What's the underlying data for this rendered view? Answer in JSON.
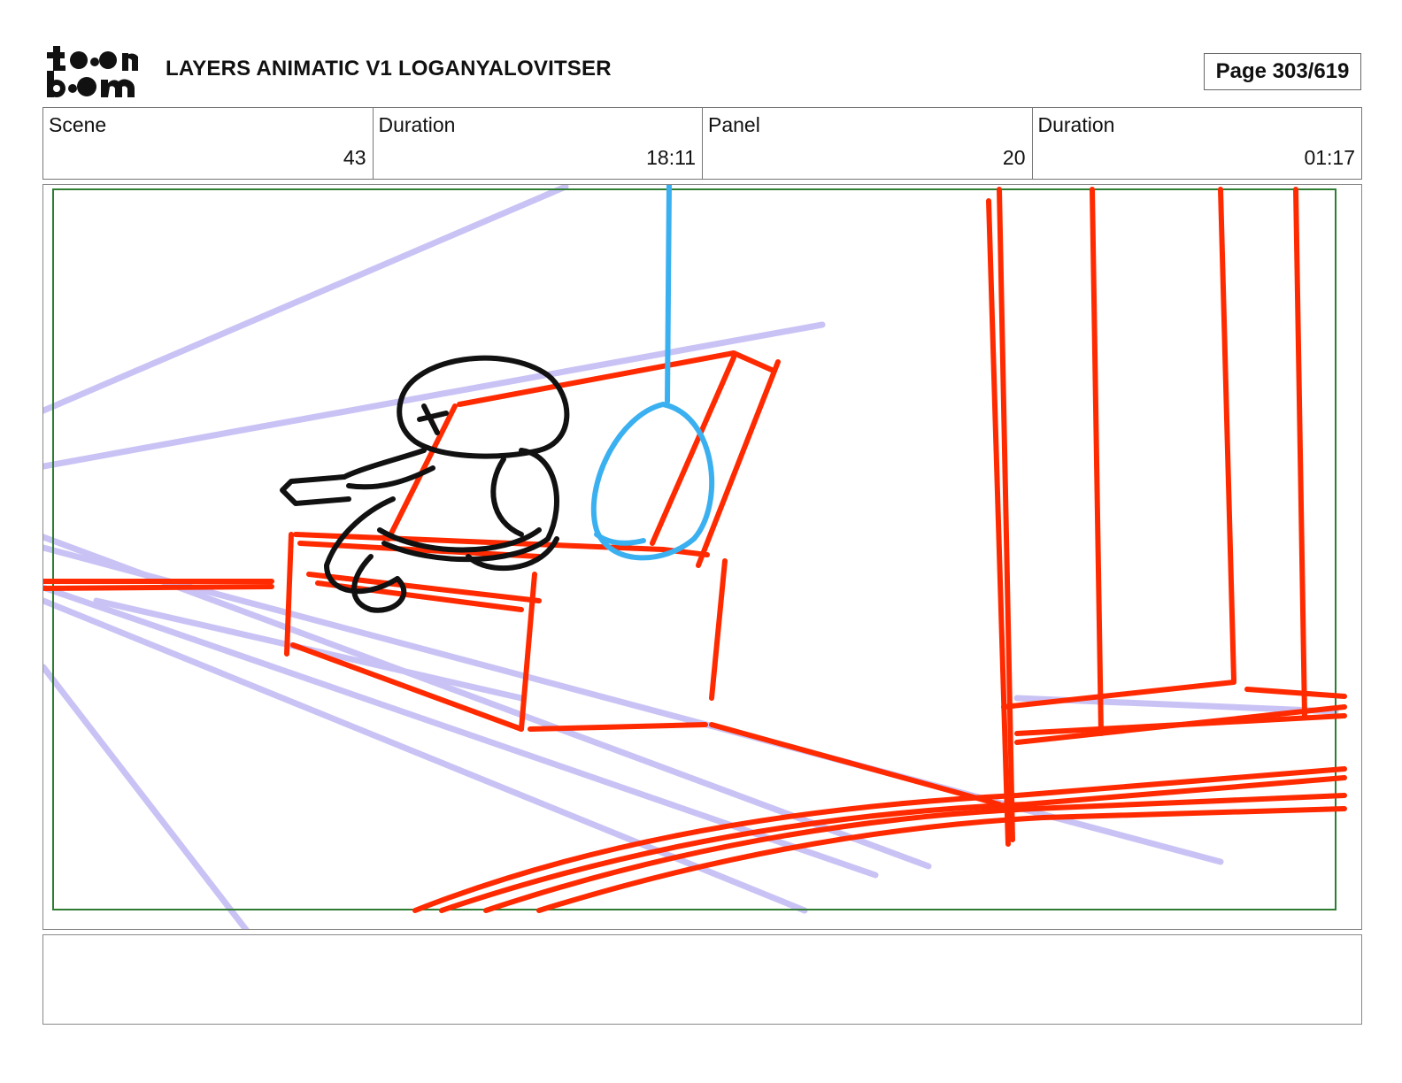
{
  "header": {
    "logo_text": "toon boom",
    "title": "LAYERS ANIMATIC V1 LOGANYALOVITSER",
    "page_label": "Page 303/619"
  },
  "info": [
    {
      "label": "Scene",
      "value": "43"
    },
    {
      "label": "Duration",
      "value": "18:11"
    },
    {
      "label": "Panel",
      "value": "20"
    },
    {
      "label": "Duration",
      "value": "01:17"
    }
  ],
  "panel": {
    "colors": {
      "safe_frame": "#2e7d32",
      "guides": "#c9c3f5",
      "layout": "#ff2a00",
      "character": "#111111",
      "prop": "#3bb0f0"
    }
  },
  "caption": {
    "text": ""
  }
}
